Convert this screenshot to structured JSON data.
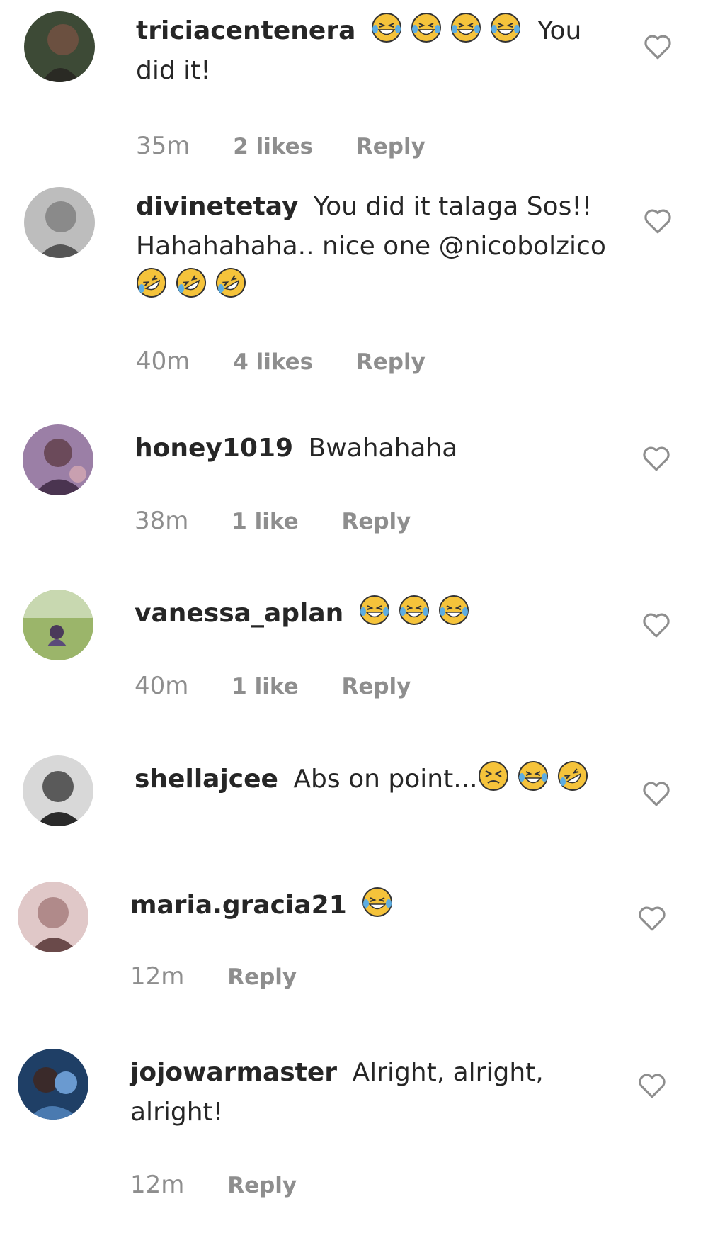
{
  "comments": [
    {
      "username": "triciacentenera",
      "text_before": "",
      "emojis": [
        "grinning-squint-tears-emoji",
        "grinning-squint-tears-emoji",
        "grinning-squint-tears-emoji",
        "grinning-squint-tears-emoji"
      ],
      "text_after": "You did it!",
      "time": "35m",
      "likes": "2 likes",
      "reply": "Reply",
      "avatar_color": "#3d4a36"
    },
    {
      "username": "divinetetay",
      "text_before": "You did it talaga Sos!! Hahahahaha.. nice one @nicobolzico",
      "emojis": [
        "rolling-laughing-emoji",
        "rolling-laughing-emoji",
        "rolling-laughing-emoji"
      ],
      "text_after": "",
      "time": "40m",
      "likes": "4 likes",
      "reply": "Reply",
      "avatar_color": "#8a8a8a"
    },
    {
      "username": "honey1019",
      "text_before": "Bwahahaha",
      "emojis": [],
      "text_after": "",
      "time": "38m",
      "likes": "1 like",
      "reply": "Reply",
      "avatar_color": "#7a5a82"
    },
    {
      "username": "vanessa_aplan",
      "text_before": "",
      "emojis": [
        "grinning-squint-tears-emoji",
        "grinning-squint-tears-emoji",
        "grinning-squint-tears-emoji"
      ],
      "text_after": "",
      "time": "40m",
      "likes": "1 like",
      "reply": "Reply",
      "avatar_color": "#7d9a4e"
    },
    {
      "username": "shellajcee",
      "text_before": "Abs on point...",
      "emojis": [
        "squinting-face-emoji",
        "grinning-squint-tears-emoji",
        "rolling-laughing-emoji"
      ],
      "text_after": "",
      "time": "",
      "likes": "",
      "reply": "",
      "avatar_color": "#5a5a5a"
    },
    {
      "username": "maria.gracia21",
      "text_before": "",
      "emojis": [
        "grinning-squint-tears-emoji"
      ],
      "text_after": "",
      "time": "12m",
      "likes": "",
      "reply": "Reply",
      "avatar_color": "#b08a8a"
    },
    {
      "username": "jojowarmaster",
      "text_before": "Alright, alright, alright!",
      "emojis": [],
      "text_after": "",
      "time": "12m",
      "likes": "",
      "reply": "Reply",
      "avatar_color": "#2f5a88"
    }
  ],
  "colors": {
    "text": "#262626",
    "meta": "#8e8e8e",
    "heart_outline": "#8e8e8e",
    "emoji_yellow": "#f5c33b",
    "emoji_tears": "#5dade2"
  },
  "icons": {
    "like": "heart-outline-icon"
  }
}
